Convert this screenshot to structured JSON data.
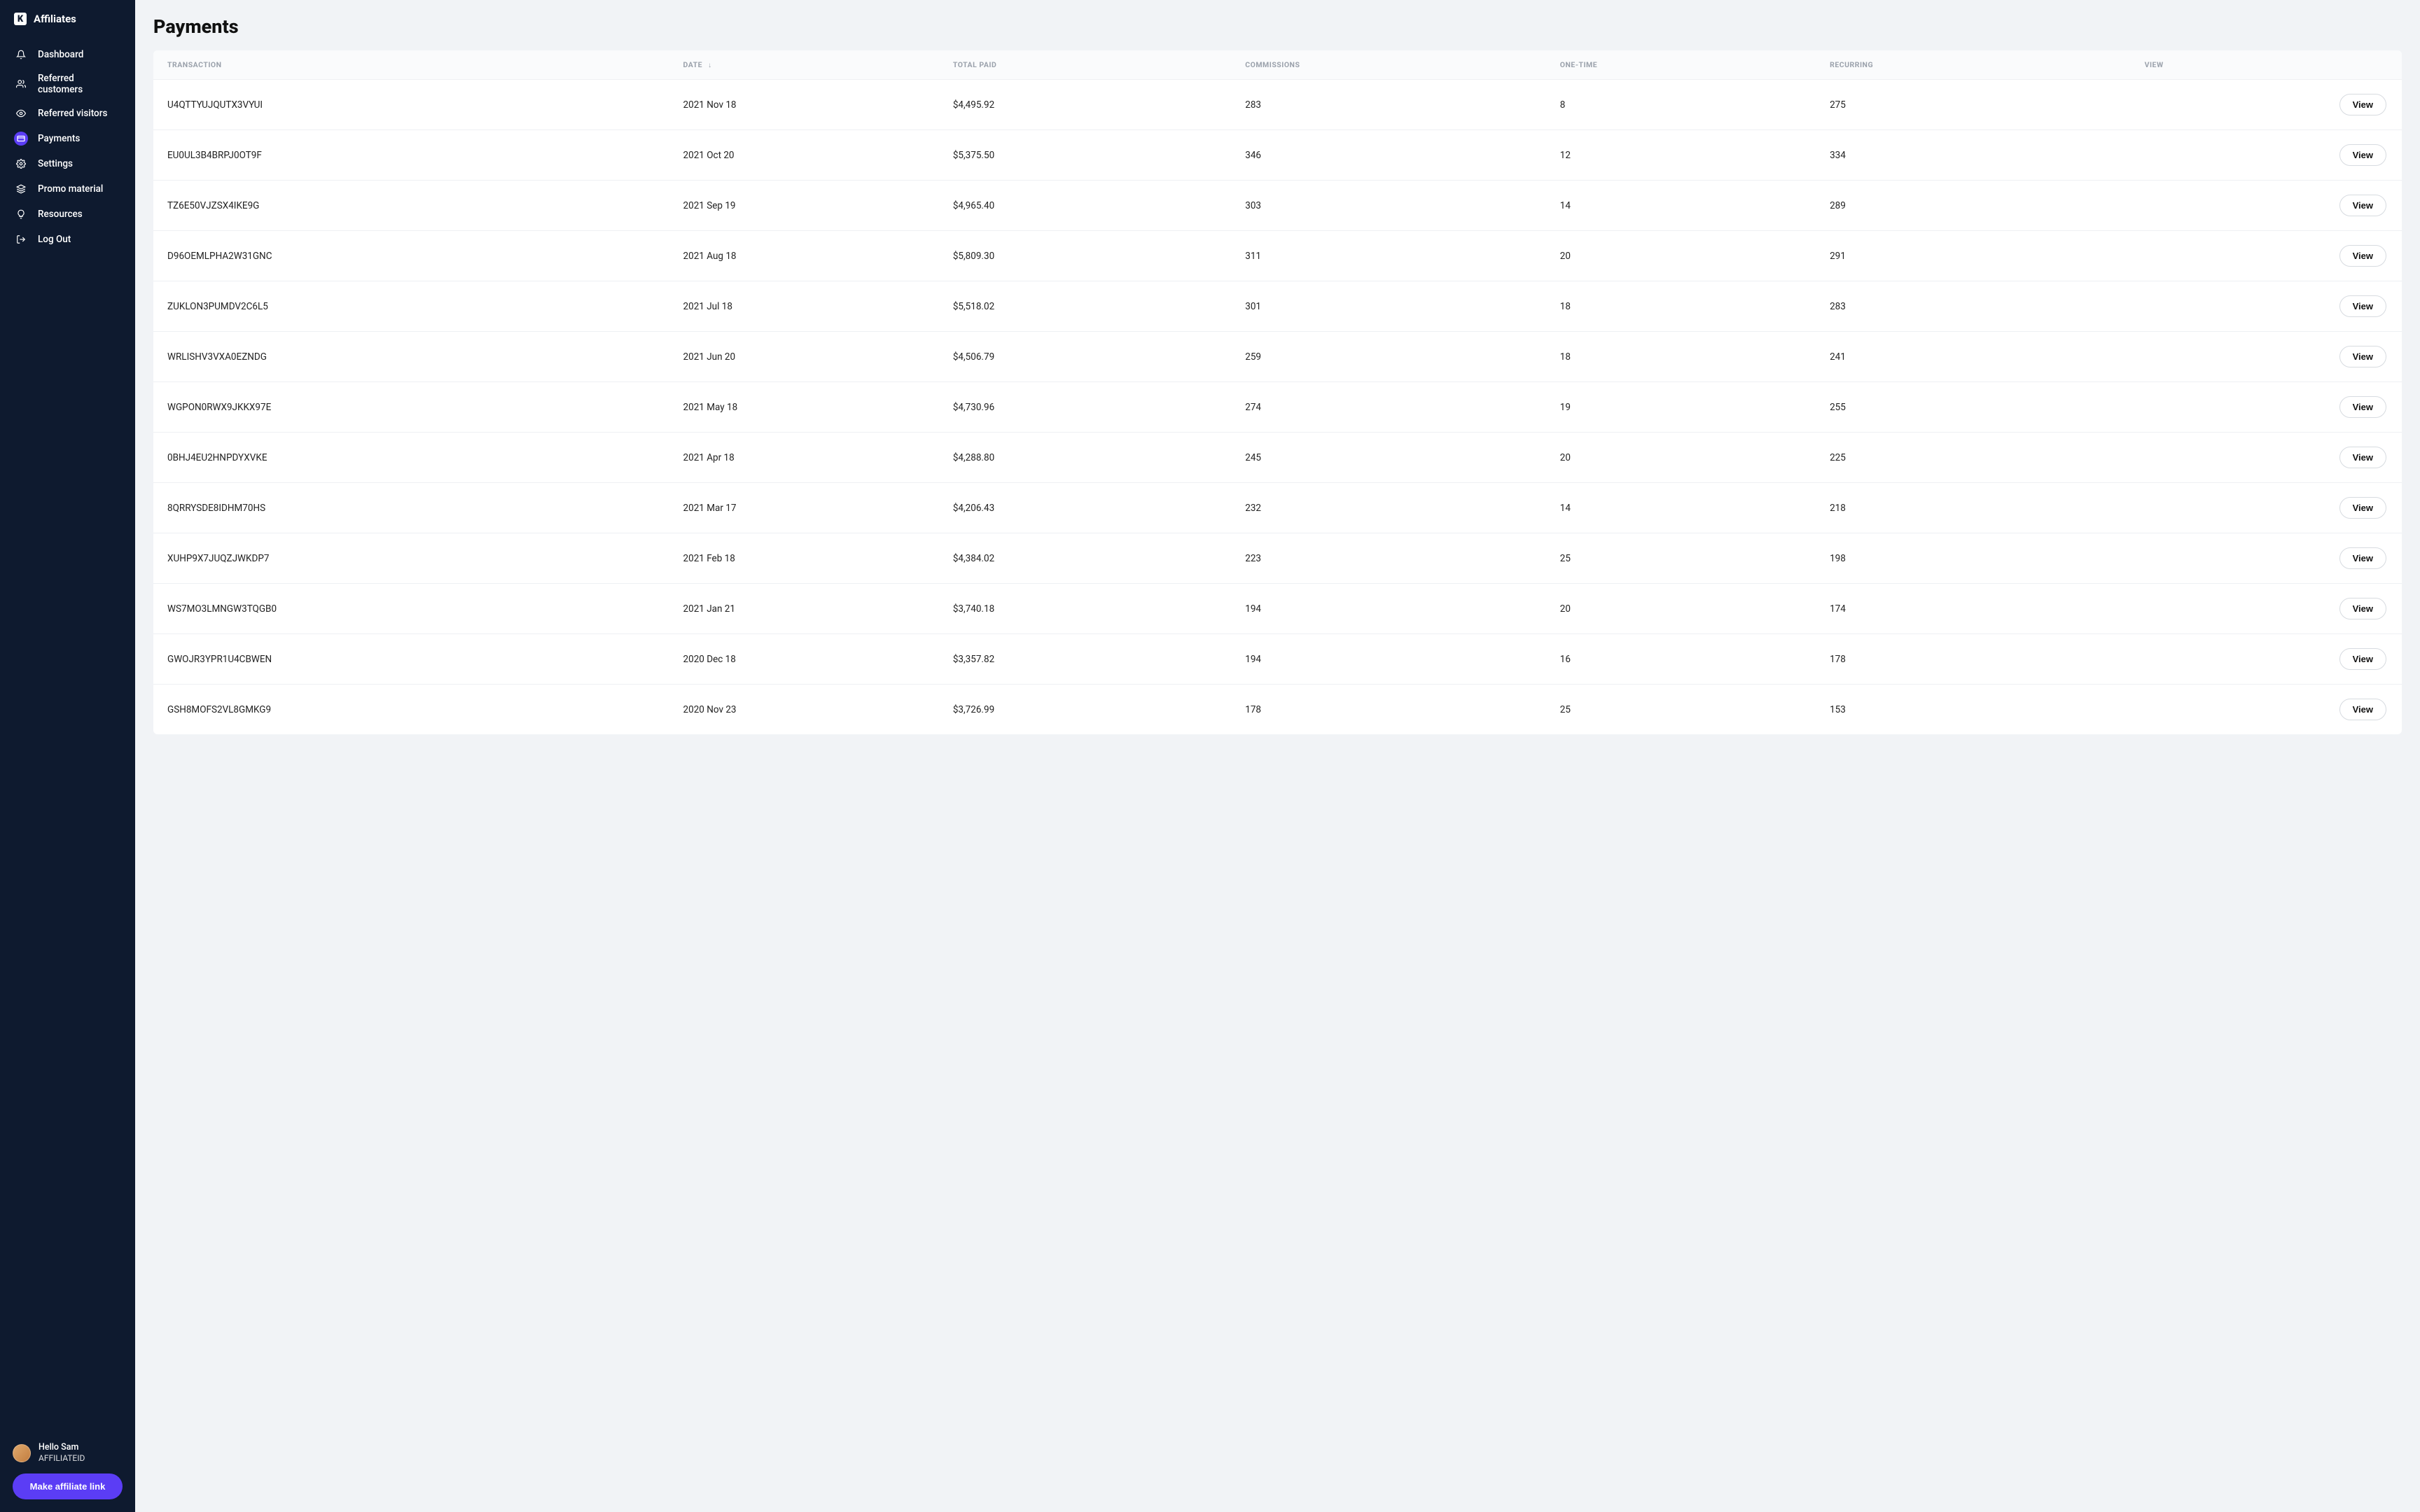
{
  "brand": {
    "name": "Affiliates",
    "mark": "K"
  },
  "sidebar": {
    "items": [
      {
        "label": "Dashboard",
        "icon": "bell"
      },
      {
        "label": "Referred customers",
        "icon": "users"
      },
      {
        "label": "Referred visitors",
        "icon": "eye"
      },
      {
        "label": "Payments",
        "icon": "card",
        "active": true
      },
      {
        "label": "Settings",
        "icon": "gear"
      },
      {
        "label": "Promo material",
        "icon": "layers"
      },
      {
        "label": "Resources",
        "icon": "bulb"
      },
      {
        "label": "Log Out",
        "icon": "logout"
      }
    ]
  },
  "user": {
    "greeting": "Hello Sam",
    "id": "AFFILIATEID"
  },
  "cta": {
    "make_link": "Make affiliate link"
  },
  "page": {
    "title": "Payments"
  },
  "table": {
    "headers": {
      "transaction": "TRANSACTION",
      "date": "DATE",
      "sort_indicator": "↓",
      "total_paid": "TOTAL PAID",
      "commissions": "COMMISSIONS",
      "one_time": "ONE-TIME",
      "recurring": "RECURRING",
      "view": "VIEW"
    },
    "view_label": "View",
    "rows": [
      {
        "transaction": "U4QTTYUJQUTX3VYUI",
        "date": "2021 Nov 18",
        "total_paid": "$4,495.92",
        "commissions": "283",
        "one_time": "8",
        "recurring": "275"
      },
      {
        "transaction": "EU0UL3B4BRPJ0OT9F",
        "date": "2021 Oct 20",
        "total_paid": "$5,375.50",
        "commissions": "346",
        "one_time": "12",
        "recurring": "334"
      },
      {
        "transaction": "TZ6E50VJZSX4IKE9G",
        "date": "2021 Sep 19",
        "total_paid": "$4,965.40",
        "commissions": "303",
        "one_time": "14",
        "recurring": "289"
      },
      {
        "transaction": "D96OEMLPHA2W31GNC",
        "date": "2021 Aug 18",
        "total_paid": "$5,809.30",
        "commissions": "311",
        "one_time": "20",
        "recurring": "291"
      },
      {
        "transaction": "ZUKLON3PUMDV2C6L5",
        "date": "2021 Jul 18",
        "total_paid": "$5,518.02",
        "commissions": "301",
        "one_time": "18",
        "recurring": "283"
      },
      {
        "transaction": "WRLISHV3VXA0EZNDG",
        "date": "2021 Jun 20",
        "total_paid": "$4,506.79",
        "commissions": "259",
        "one_time": "18",
        "recurring": "241"
      },
      {
        "transaction": "WGPON0RWX9JKKX97E",
        "date": "2021 May 18",
        "total_paid": "$4,730.96",
        "commissions": "274",
        "one_time": "19",
        "recurring": "255"
      },
      {
        "transaction": "0BHJ4EU2HNPDYXVKE",
        "date": "2021 Apr 18",
        "total_paid": "$4,288.80",
        "commissions": "245",
        "one_time": "20",
        "recurring": "225"
      },
      {
        "transaction": "8QRRYSDE8IDHM70HS",
        "date": "2021 Mar 17",
        "total_paid": "$4,206.43",
        "commissions": "232",
        "one_time": "14",
        "recurring": "218"
      },
      {
        "transaction": "XUHP9X7JUQZJWKDP7",
        "date": "2021 Feb 18",
        "total_paid": "$4,384.02",
        "commissions": "223",
        "one_time": "25",
        "recurring": "198"
      },
      {
        "transaction": "WS7MO3LMNGW3TQGB0",
        "date": "2021 Jan 21",
        "total_paid": "$3,740.18",
        "commissions": "194",
        "one_time": "20",
        "recurring": "174"
      },
      {
        "transaction": "GWOJR3YPR1U4CBWEN",
        "date": "2020 Dec 18",
        "total_paid": "$3,357.82",
        "commissions": "194",
        "one_time": "16",
        "recurring": "178"
      },
      {
        "transaction": "GSH8MOFS2VL8GMKG9",
        "date": "2020 Nov 23",
        "total_paid": "$3,726.99",
        "commissions": "178",
        "one_time": "25",
        "recurring": "153"
      }
    ]
  }
}
